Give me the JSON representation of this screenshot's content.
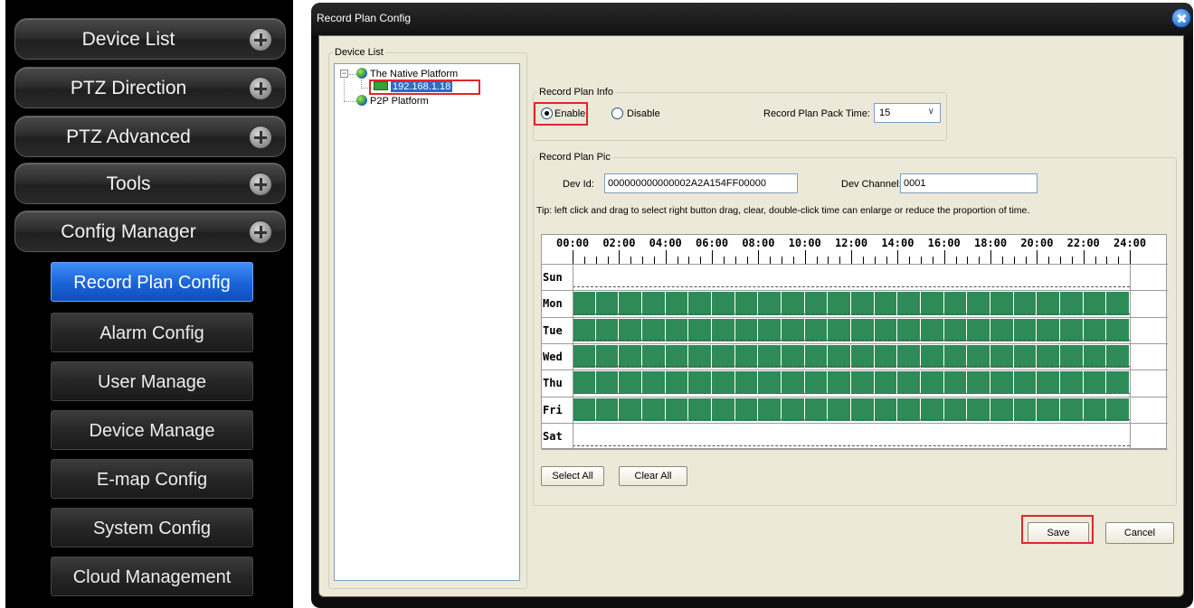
{
  "menu": {
    "groups": [
      {
        "label": "Device List"
      },
      {
        "label": "PTZ Direction"
      },
      {
        "label": "PTZ Advanced"
      },
      {
        "label": "Tools"
      },
      {
        "label": "Config Manager"
      }
    ],
    "submenu": [
      {
        "label": "Record Plan Config",
        "active": true
      },
      {
        "label": "Alarm Config"
      },
      {
        "label": "User Manage"
      },
      {
        "label": "Device Manage"
      },
      {
        "label": "E-map Config"
      },
      {
        "label": "System Config"
      },
      {
        "label": "Cloud Management"
      }
    ]
  },
  "dialog": {
    "title": "Record Plan Config",
    "device_list": {
      "legend": "Device List",
      "tree": {
        "native_platform": "The Native Platform",
        "device_ip": "192.168.1.18",
        "p2p_platform": "P2P Platform"
      }
    },
    "plan_info": {
      "legend": "Record Plan Info",
      "enable_label": "Enable",
      "disable_label": "Disable",
      "selected": "Enable",
      "pack_time_label": "Record Plan Pack Time:",
      "pack_time_value": "15"
    },
    "plan_pic": {
      "legend": "Record Plan Pic",
      "dev_id_label": "Dev Id:",
      "dev_id_value": "000000000000002A2A154FF00000",
      "dev_channel_label": "Dev Channel:",
      "dev_channel_value": "0001",
      "tip": "Tip: left click and drag to select right button drag, clear, double-click time can enlarge or reduce the proportion of time.",
      "hours": [
        "00:00",
        "02:00",
        "04:00",
        "06:00",
        "08:00",
        "10:00",
        "12:00",
        "14:00",
        "16:00",
        "18:00",
        "20:00",
        "22:00",
        "24:00"
      ],
      "days": [
        "Sun",
        "Mon",
        "Tue",
        "Wed",
        "Thu",
        "Fri",
        "Sat"
      ],
      "scheduled": [
        false,
        true,
        true,
        true,
        true,
        true,
        false
      ],
      "select_all": "Select All",
      "clear_all": "Clear All"
    },
    "save": "Save",
    "cancel": "Cancel",
    "colors": {
      "schedule_fill": "#2e8b57",
      "active_menu": "#1a63d8",
      "highlight": "#e2262b"
    }
  }
}
